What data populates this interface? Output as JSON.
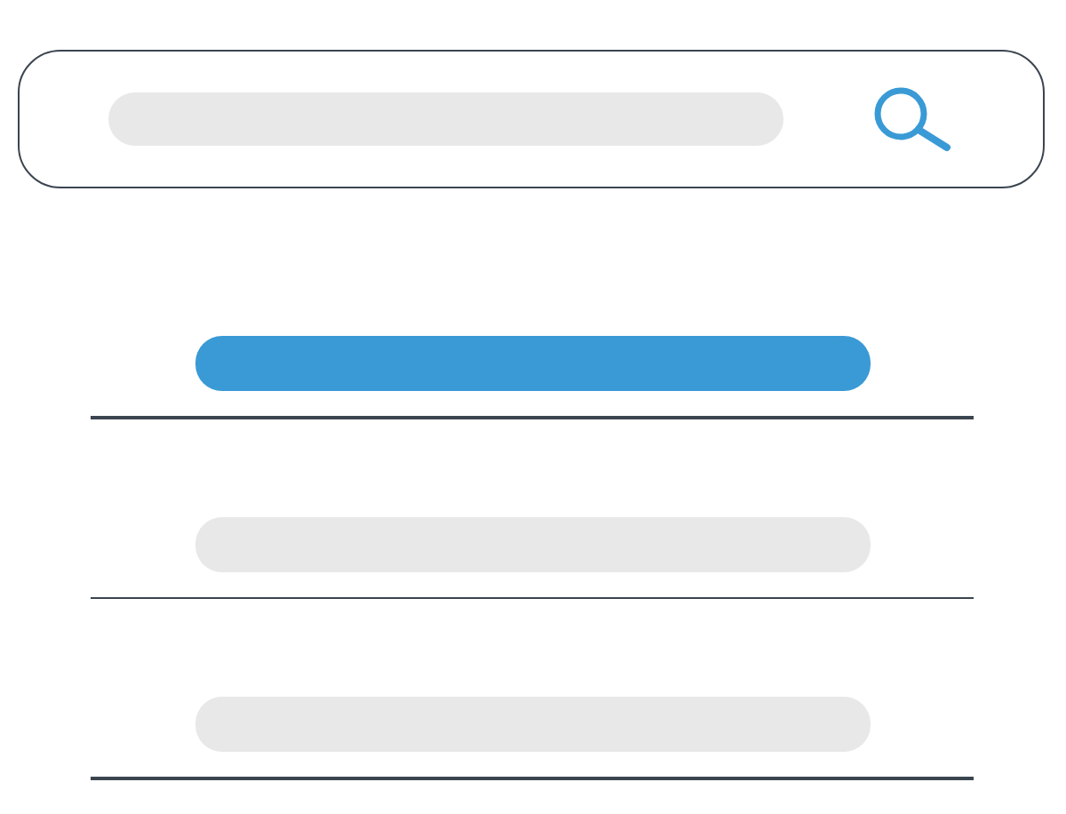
{
  "results": [
    {
      "selected": true
    },
    {
      "selected": false
    },
    {
      "selected": false
    }
  ]
}
